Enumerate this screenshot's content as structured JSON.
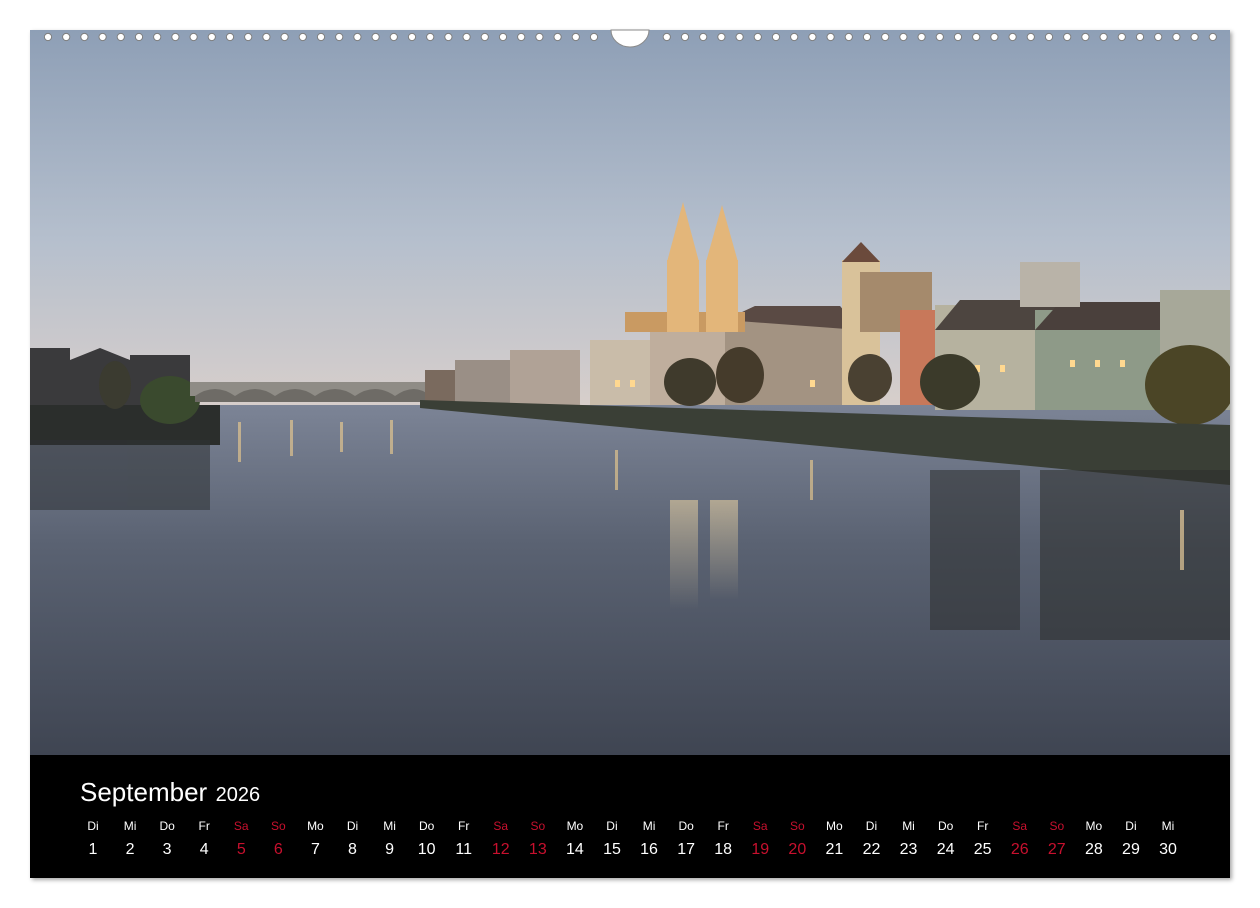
{
  "calendar": {
    "month": "September",
    "year": "2026",
    "weekend_color": "#c8102e",
    "text_color": "#ffffff",
    "days": [
      {
        "label": "Di",
        "number": "1"
      },
      {
        "label": "Mi",
        "number": "2"
      },
      {
        "label": "Do",
        "number": "3"
      },
      {
        "label": "Fr",
        "number": "4"
      },
      {
        "label": "Sa",
        "number": "5",
        "weekend": true
      },
      {
        "label": "So",
        "number": "6",
        "weekend": true
      },
      {
        "label": "Mo",
        "number": "7"
      },
      {
        "label": "Di",
        "number": "8"
      },
      {
        "label": "Mi",
        "number": "9"
      },
      {
        "label": "Do",
        "number": "10"
      },
      {
        "label": "Fr",
        "number": "11"
      },
      {
        "label": "Sa",
        "number": "12",
        "weekend": true
      },
      {
        "label": "So",
        "number": "13",
        "weekend": true
      },
      {
        "label": "Mo",
        "number": "14"
      },
      {
        "label": "Di",
        "number": "15"
      },
      {
        "label": "Mi",
        "number": "16"
      },
      {
        "label": "Do",
        "number": "17"
      },
      {
        "label": "Fr",
        "number": "18"
      },
      {
        "label": "Sa",
        "number": "19",
        "weekend": true
      },
      {
        "label": "So",
        "number": "20",
        "weekend": true
      },
      {
        "label": "Mo",
        "number": "21"
      },
      {
        "label": "Di",
        "number": "22"
      },
      {
        "label": "Mi",
        "number": "23"
      },
      {
        "label": "Do",
        "number": "24"
      },
      {
        "label": "Fr",
        "number": "25"
      },
      {
        "label": "Sa",
        "number": "26",
        "weekend": true
      },
      {
        "label": "So",
        "number": "27",
        "weekend": true
      },
      {
        "label": "Mo",
        "number": "28"
      },
      {
        "label": "Di",
        "number": "29"
      },
      {
        "label": "Mi",
        "number": "30"
      }
    ]
  },
  "photo": {
    "sky_top": "#a9b6c8",
    "sky_horizon": "#d2c9c8",
    "water_color": "#5c6472",
    "light_color": "#ffd890"
  }
}
